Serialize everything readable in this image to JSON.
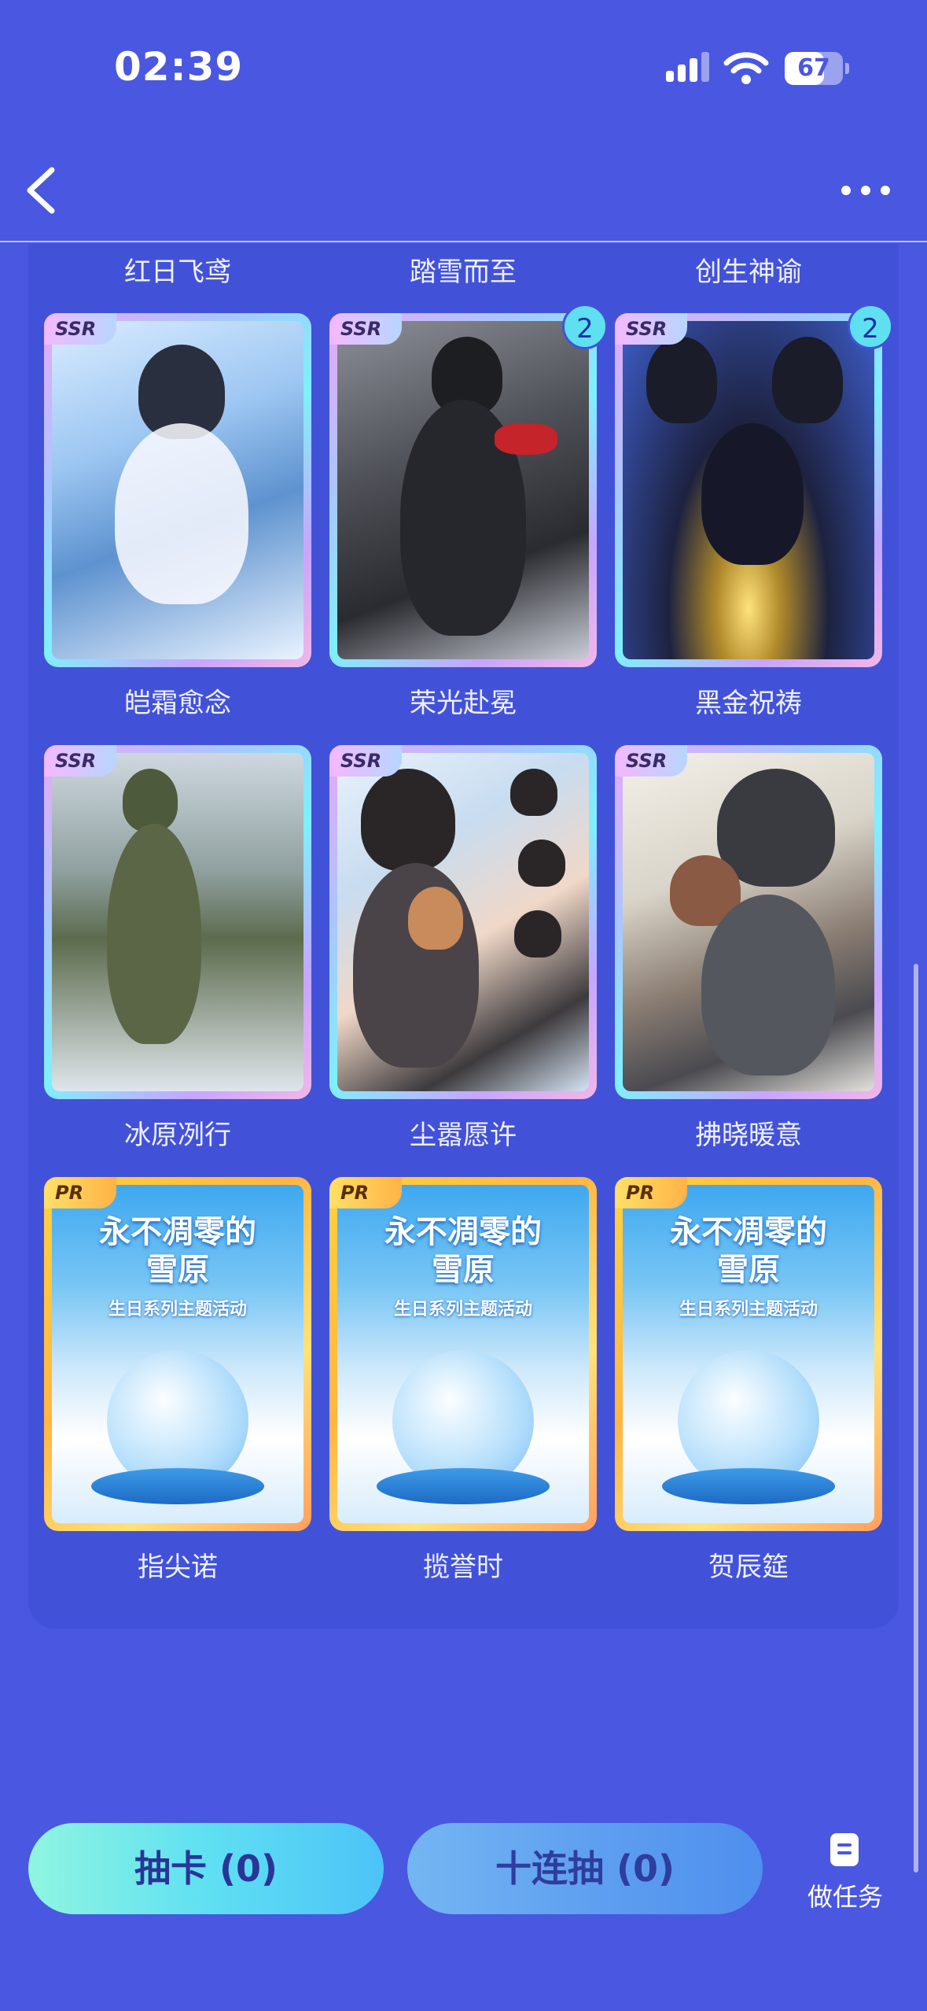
{
  "status_bar": {
    "time": "02:39",
    "battery": "67",
    "battery_level": 0.67
  },
  "top_row_labels": [
    "红日飞鸢",
    "踏雪而至",
    "创生神谕"
  ],
  "cards": [
    {
      "rarity": "SSR",
      "name": "皑霜愈念",
      "count": ""
    },
    {
      "rarity": "SSR",
      "name": "荣光赴冕",
      "count": "2"
    },
    {
      "rarity": "SSR",
      "name": "黑金祝祷",
      "count": "2"
    },
    {
      "rarity": "SSR",
      "name": "冰原冽行",
      "count": ""
    },
    {
      "rarity": "SSR",
      "name": "尘嚣愿许",
      "count": ""
    },
    {
      "rarity": "SSR",
      "name": "拂晓暖意",
      "count": ""
    },
    {
      "rarity": "PR",
      "name": "指尖诺",
      "count": ""
    },
    {
      "rarity": "PR",
      "name": "揽誉时",
      "count": ""
    },
    {
      "rarity": "PR",
      "name": "贺辰筵",
      "count": ""
    }
  ],
  "pr_art": {
    "title_line1": "永不凋零的",
    "title_line2": "雪原",
    "subtitle": "生日系列主题活动"
  },
  "actions": {
    "draw_label": "抽卡 (0)",
    "ten_draw_label": "十连抽 (0)",
    "task_label": "做任务"
  },
  "icons": {
    "back": "chevron-left-icon",
    "more": "more-dots-icon",
    "task": "task-list-icon",
    "signal": "signal-icon",
    "wifi": "wifi-icon",
    "battery": "battery-icon"
  }
}
